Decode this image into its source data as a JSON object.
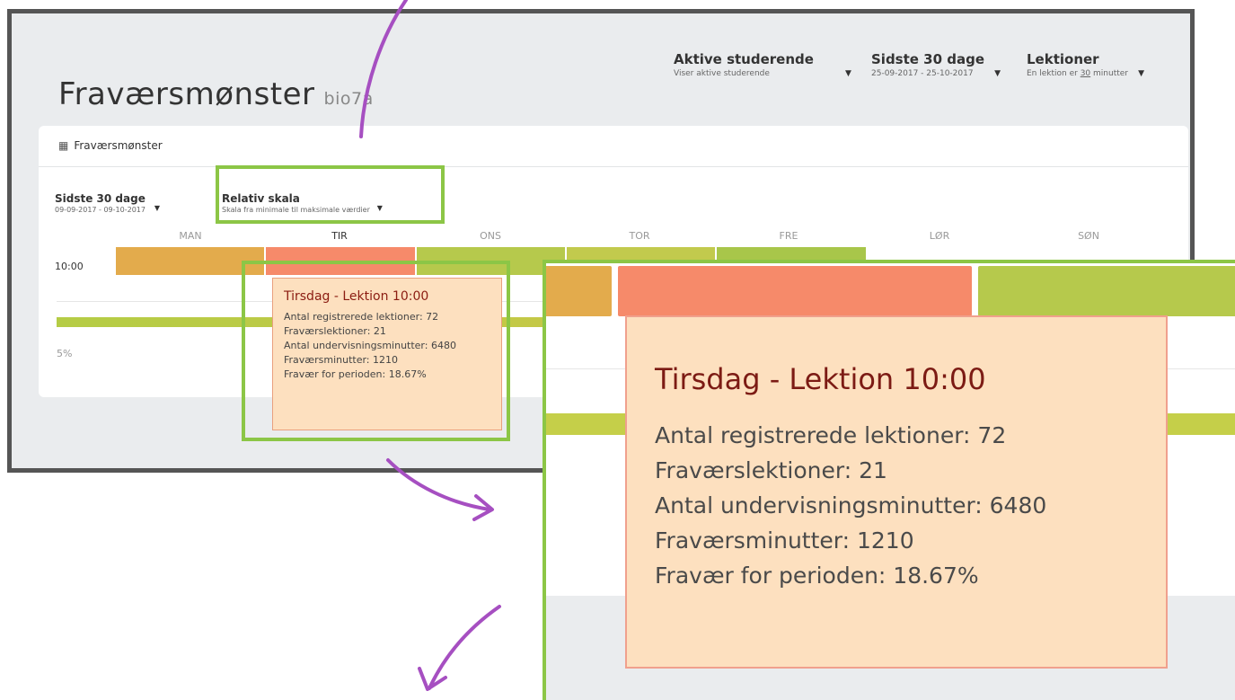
{
  "header": {
    "title": "Fraværsmønster",
    "subtitle": "bio7a",
    "filters": [
      {
        "title": "Aktive studerende",
        "sub": "Viser aktive studerende"
      },
      {
        "title": "Sidste 30 dage",
        "sub": "25-09-2017 - 25-10-2017"
      },
      {
        "title": "Lektioner",
        "sub_prefix": "En lektion er ",
        "sub_value": "30",
        "sub_suffix": " minutter"
      }
    ]
  },
  "card": {
    "title": "Fraværsmønster",
    "period": {
      "title": "Sidste 30 dage",
      "sub": "09-09-2017 - 09-10-2017"
    },
    "scale": {
      "title": "Relativ skala",
      "sub": "Skala fra minimale til maksimale værdier"
    },
    "days": [
      "MAN",
      "TIR",
      "ONS",
      "TOR",
      "FRE",
      "LØR",
      "SØN"
    ],
    "time": "10:00",
    "legend_pct": "5%",
    "cells": [
      {
        "day": "MAN",
        "color": "#e3ab4c"
      },
      {
        "day": "TIR",
        "color": "#f68a6a"
      },
      {
        "day": "ONS",
        "color": "#b6c94c"
      },
      {
        "day": "TOR",
        "color": "#c2ca4d"
      },
      {
        "day": "FRE",
        "color": "#a8c64a"
      }
    ]
  },
  "tooltip": {
    "title": "Tirsdag - Lektion 10:00",
    "lines": [
      "Antal registrerede lektioner: 72",
      "Fraværslektioner: 21",
      "Antal undervisningsminutter: 6480",
      "Fraværsminutter: 1210",
      "Fravær for perioden: 18.67%"
    ]
  },
  "colors": {
    "highlight": "#8cc646",
    "annotation_arrow": "#a64fc1"
  }
}
